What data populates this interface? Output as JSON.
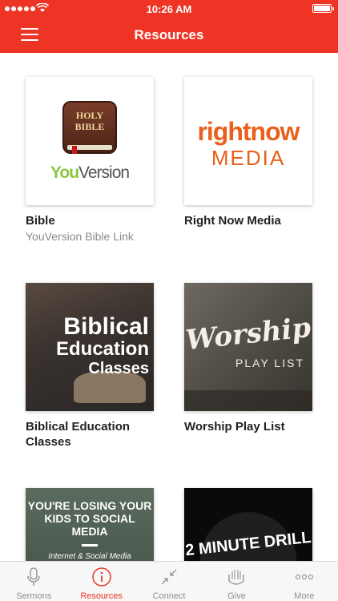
{
  "status_bar": {
    "time": "10:26 AM"
  },
  "header": {
    "title": "Resources"
  },
  "cards": [
    {
      "title": "Bible",
      "subtitle": "YouVersion Bible Link",
      "art": {
        "book_text": "HOLY BIBLE",
        "logo_you": "You",
        "logo_version": "Version"
      }
    },
    {
      "title": "Right Now Media",
      "subtitle": "",
      "art": {
        "line1": "rightnow",
        "line2": "MEDIA"
      }
    },
    {
      "title": "Biblical Education Classes",
      "subtitle": "",
      "art": {
        "line1": "Biblical",
        "line2": "Education",
        "line3": "Classes"
      }
    },
    {
      "title": "Worship Play List",
      "subtitle": "",
      "art": {
        "line1": "Worship",
        "line2": "PLAY LIST"
      }
    },
    {
      "title": "",
      "subtitle": "",
      "art": {
        "line1": "YOU'RE LOSING YOUR KIDS TO SOCIAL MEDIA",
        "line2": "Internet & Social Media"
      }
    },
    {
      "title": "",
      "subtitle": "",
      "art": {
        "line1": "2 MINUTE DRILL"
      }
    }
  ],
  "tabbar": {
    "tabs": [
      {
        "label": "Sermons",
        "icon": "microphone-icon"
      },
      {
        "label": "Resources",
        "icon": "info-icon",
        "active": true
      },
      {
        "label": "Connect",
        "icon": "arrows-in-icon"
      },
      {
        "label": "Give",
        "icon": "hands-icon"
      },
      {
        "label": "More",
        "icon": "more-dots-icon"
      }
    ]
  },
  "colors": {
    "accent": "#ee3424",
    "orange": "#e8601c",
    "youversion_green": "#8cc63f"
  }
}
